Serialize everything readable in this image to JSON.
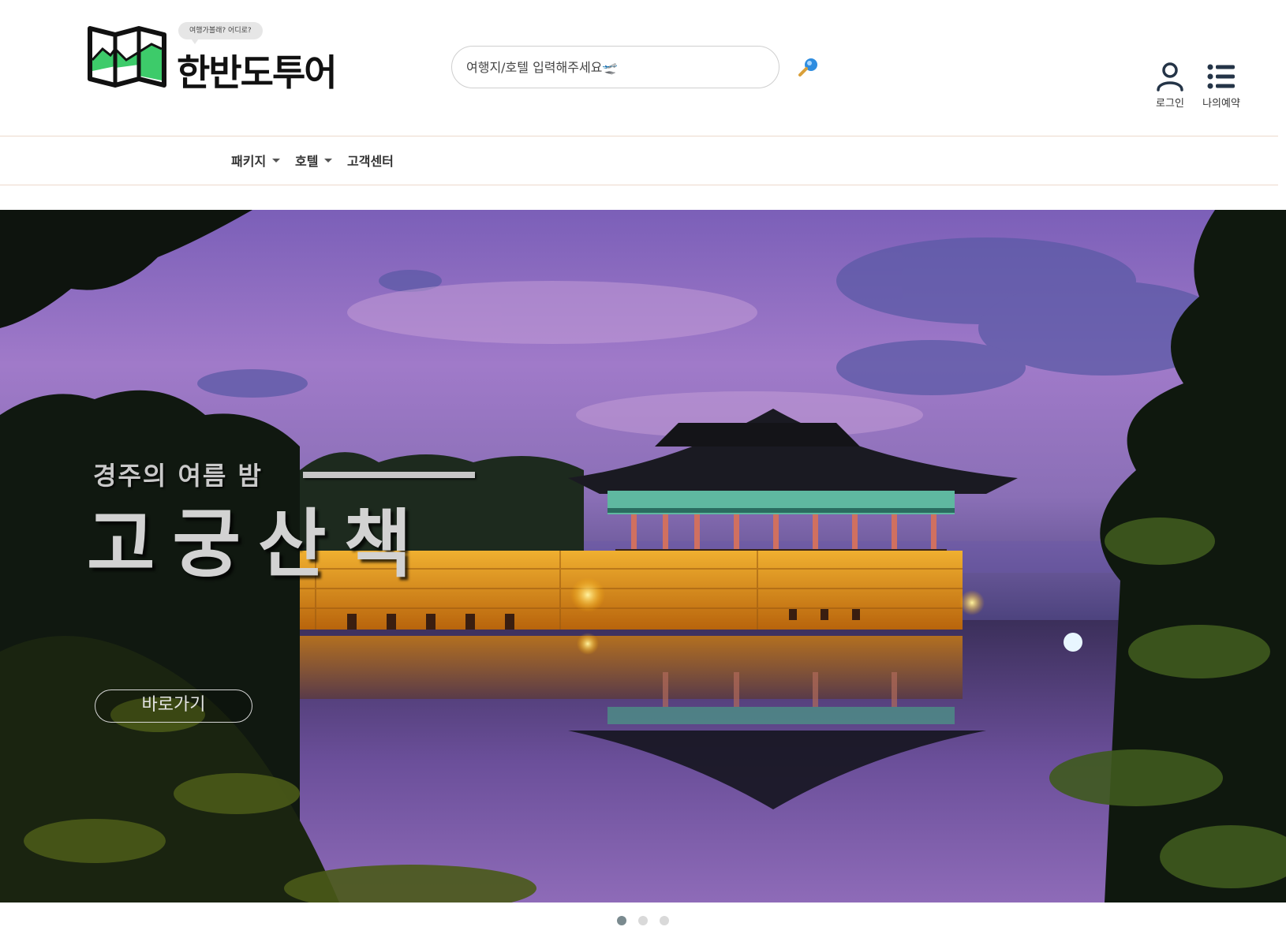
{
  "brand": {
    "name": "한반도투어",
    "tagline": "여행가볼래? 어디로?"
  },
  "search": {
    "placeholder": "여행지/호텔 입력해주세요🛫",
    "button_icon": "magnifier-icon"
  },
  "utilities": {
    "login_label": "로그인",
    "login_icon": "user-icon",
    "booking_label": "나의예약",
    "booking_icon": "list-icon"
  },
  "nav": {
    "items": [
      {
        "label": "패키지",
        "dropdown": true
      },
      {
        "label": "호텔",
        "dropdown": true
      },
      {
        "label": "고객센터",
        "dropdown": false
      }
    ]
  },
  "hero": {
    "subtitle": "경주의 여름 밤",
    "title": "고궁산책",
    "cta_label": "바로가기",
    "slide_count": 3,
    "active_slide": 1
  },
  "colors": {
    "accent_green": "#3dcb6a",
    "divider": "#ecd9cc",
    "dot_active": "#7a8a8f",
    "dot_inactive": "#d9d9d9"
  }
}
